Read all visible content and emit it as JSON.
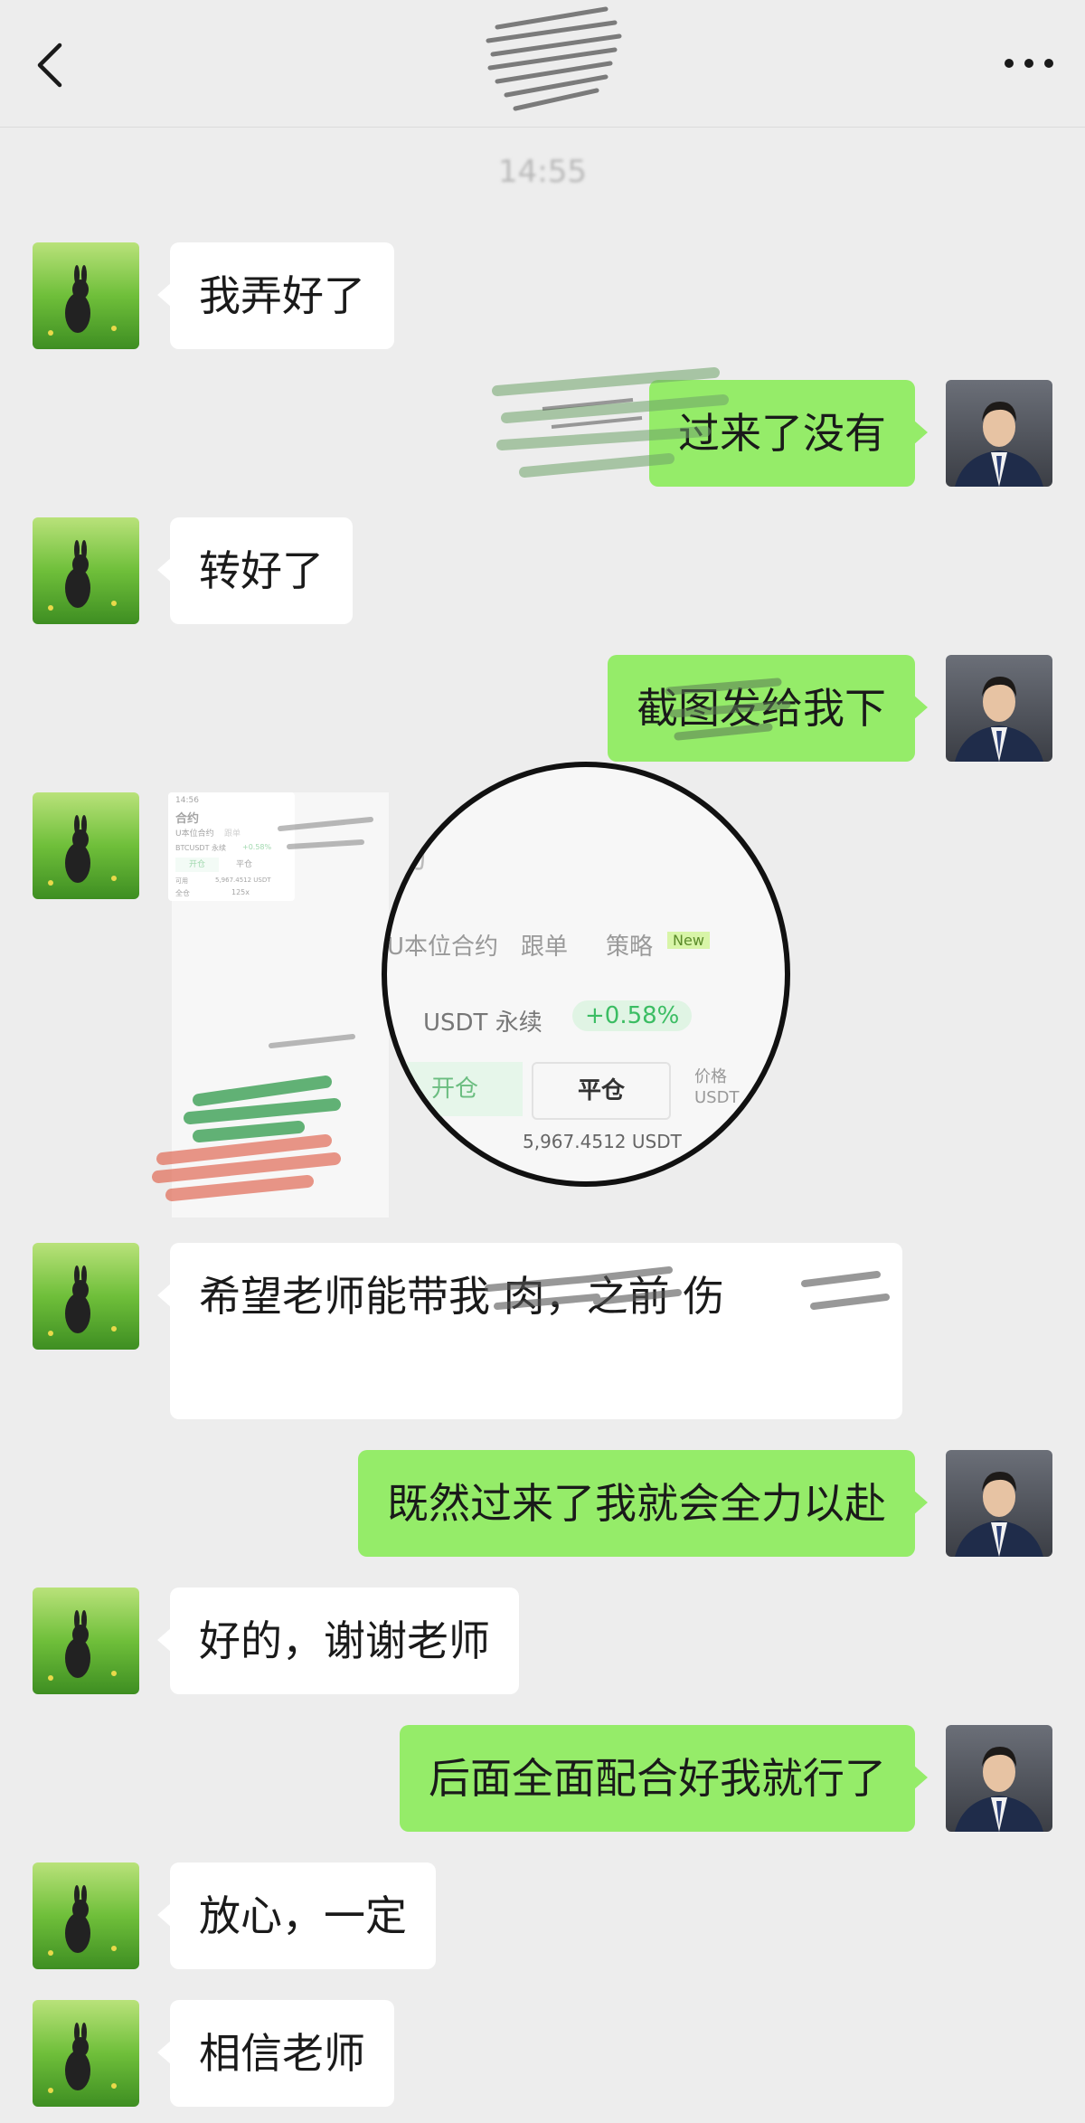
{
  "header": {
    "back_icon": "chevron-left-icon",
    "more_icon": "ellipsis-icon",
    "more_label": "···"
  },
  "timestamp": "14:55",
  "messages": [
    {
      "side": "left",
      "text": "我弄好了"
    },
    {
      "side": "right",
      "text": "过来了没有"
    },
    {
      "side": "left",
      "text": "转好了"
    },
    {
      "side": "right",
      "text": "截图发给我下"
    },
    {
      "side": "left",
      "type": "image"
    },
    {
      "side": "left",
      "text": "希望老师能带我 肉，之前 伤"
    },
    {
      "side": "right",
      "text": "既然过来了我就会全力以赴"
    },
    {
      "side": "left",
      "text": "好的，谢谢老师"
    },
    {
      "side": "right",
      "text": "后面全面配合好我就行了"
    },
    {
      "side": "left",
      "text": "放心，一定"
    },
    {
      "side": "left",
      "text": "相信老师"
    }
  ],
  "screenshot": {
    "time": "14:56",
    "title": "合约",
    "tabs": [
      "U本位合约",
      "跟单",
      "策略"
    ],
    "new_badge": "New",
    "pair": "BTCUSDT 永续",
    "change": "+0.58%",
    "open": "开仓",
    "close": "平仓",
    "balance": "5,967.4512 USDT",
    "leverage": "125x",
    "all": "全仓",
    "available": "可用",
    "price": "价格",
    "usdt": "USDT"
  },
  "magnifier": {
    "title": "约",
    "tab1": "U本位合约",
    "tab2": "跟单",
    "tab3": "策略",
    "new_badge": "New",
    "pair": "USDT 永续",
    "change": "+0.58%",
    "open": "开仓",
    "close": "平仓",
    "balance": "5,967.4512 USDT",
    "price": "价格",
    "usdt": "USDT"
  },
  "colors": {
    "bg": "#ededed",
    "left_bubble": "#ffffff",
    "right_bubble": "#95ec69"
  }
}
